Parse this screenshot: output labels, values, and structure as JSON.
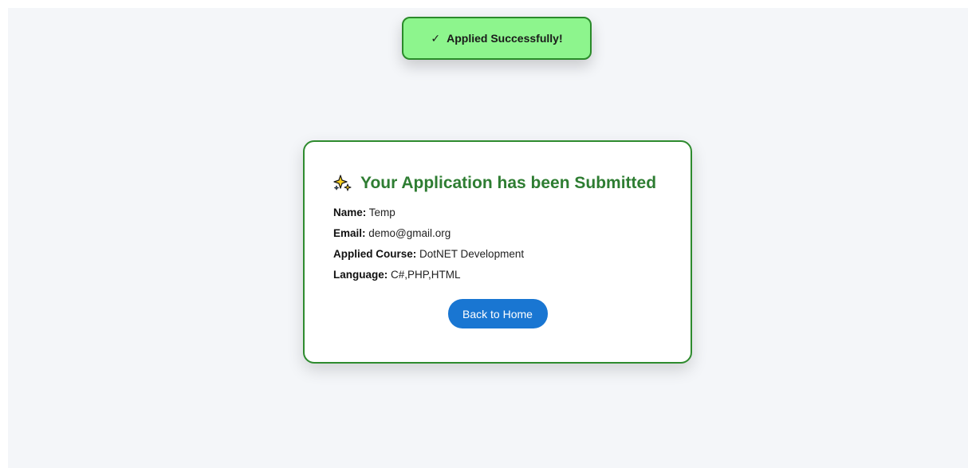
{
  "toast": {
    "icon": "check-icon",
    "check_glyph": "✓",
    "message": "Applied Successfully!"
  },
  "card": {
    "icon": "sparkles-icon",
    "title": "Your Application has been Submitted",
    "details": [
      {
        "label": "Name:",
        "value": "Temp"
      },
      {
        "label": "Email:",
        "value": "demo@gmail.org"
      },
      {
        "label": "Applied Course:",
        "value": "DotNET Development"
      },
      {
        "label": "Language:",
        "value": "C#,PHP,HTML"
      }
    ],
    "button_label": "Back to Home"
  },
  "colors": {
    "toast_bg": "#8df58d",
    "toast_border": "#2a8a2a",
    "card_border": "#2e8b2e",
    "title_color": "#2e7d32",
    "button_bg": "#1976d2",
    "page_bg": "#f4f6f9"
  }
}
